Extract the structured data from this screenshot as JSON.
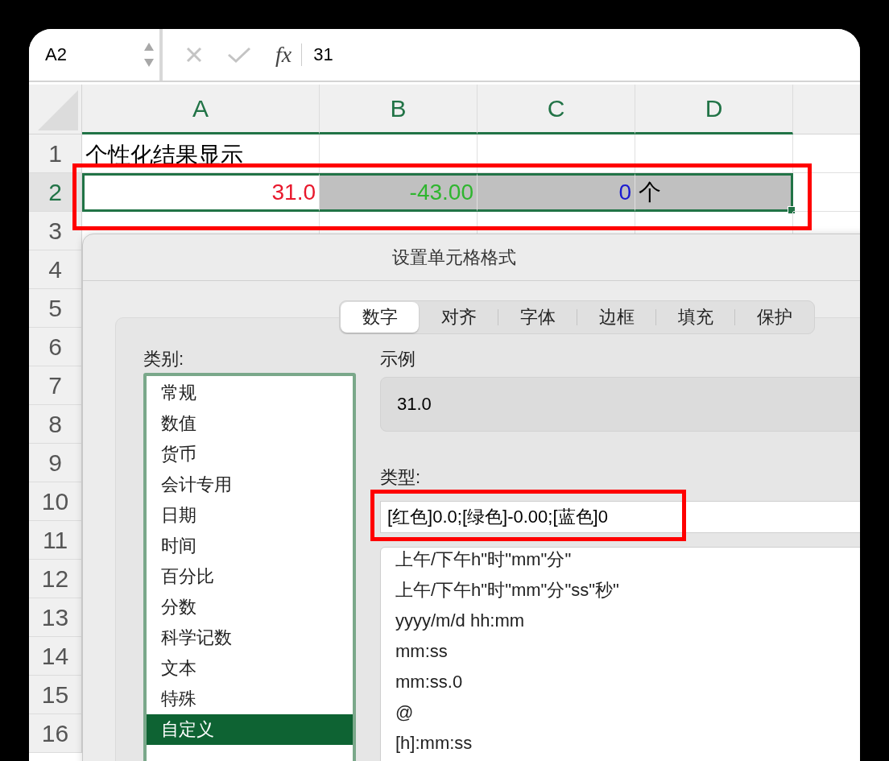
{
  "formula_bar": {
    "name_box": "A2",
    "function_label": "fx",
    "formula": "31"
  },
  "sheet": {
    "columns": [
      {
        "label": "A",
        "selected": true
      },
      {
        "label": "B",
        "selected": true
      },
      {
        "label": "C",
        "selected": true
      },
      {
        "label": "D",
        "selected": true
      }
    ],
    "rows": [
      {
        "header": "1",
        "selected": false,
        "cells": [
          {
            "kind": "text",
            "text": "个性化结果显示",
            "shaded": false
          }
        ]
      },
      {
        "header": "2",
        "selected": true,
        "cells": [
          {
            "kind": "number",
            "text": "31.0",
            "color": "#e8182c",
            "shaded": false
          },
          {
            "kind": "number",
            "text": "-43.00",
            "color": "#2fb52f",
            "shaded": true
          },
          {
            "kind": "number",
            "text": "0",
            "color": "#1a1ad0",
            "shaded": true
          },
          {
            "kind": "text",
            "text": "个",
            "color": "#000000",
            "shaded": true
          }
        ]
      },
      {
        "header": "3",
        "selected": false
      },
      {
        "header": "4",
        "selected": false
      },
      {
        "header": "5",
        "selected": false
      },
      {
        "header": "6",
        "selected": false
      },
      {
        "header": "7",
        "selected": false
      },
      {
        "header": "8",
        "selected": false
      },
      {
        "header": "9",
        "selected": false
      },
      {
        "header": "10",
        "selected": false
      },
      {
        "header": "11",
        "selected": false
      },
      {
        "header": "12",
        "selected": false
      },
      {
        "header": "13",
        "selected": false
      },
      {
        "header": "14",
        "selected": false
      },
      {
        "header": "15",
        "selected": false
      },
      {
        "header": "16",
        "selected": false
      }
    ]
  },
  "dialog": {
    "title": "设置单元格格式",
    "tabs": [
      {
        "label": "数字",
        "selected": true
      },
      {
        "label": "对齐",
        "selected": false
      },
      {
        "label": "字体",
        "selected": false
      },
      {
        "label": "边框",
        "selected": false
      },
      {
        "label": "填充",
        "selected": false
      },
      {
        "label": "保护",
        "selected": false
      }
    ],
    "category_label": "类别:",
    "categories": [
      {
        "label": "常规",
        "selected": false
      },
      {
        "label": "数值",
        "selected": false
      },
      {
        "label": "货币",
        "selected": false
      },
      {
        "label": "会计专用",
        "selected": false
      },
      {
        "label": "日期",
        "selected": false
      },
      {
        "label": "时间",
        "selected": false
      },
      {
        "label": "百分比",
        "selected": false
      },
      {
        "label": "分数",
        "selected": false
      },
      {
        "label": "科学记数",
        "selected": false
      },
      {
        "label": "文本",
        "selected": false
      },
      {
        "label": "特殊",
        "selected": false
      },
      {
        "label": "自定义",
        "selected": true
      }
    ],
    "sample_label": "示例",
    "sample": "31.0",
    "type_label": "类型:",
    "type_value": "[红色]0.0;[绿色]-0.00;[蓝色]0",
    "formats": [
      "上午/下午h\"时\"mm\"分\"",
      "上午/下午h\"时\"mm\"分\"ss\"秒\"",
      "yyyy/m/d hh:mm",
      "mm:ss",
      "mm:ss.0",
      "@",
      "[h]:mm:ss"
    ]
  }
}
